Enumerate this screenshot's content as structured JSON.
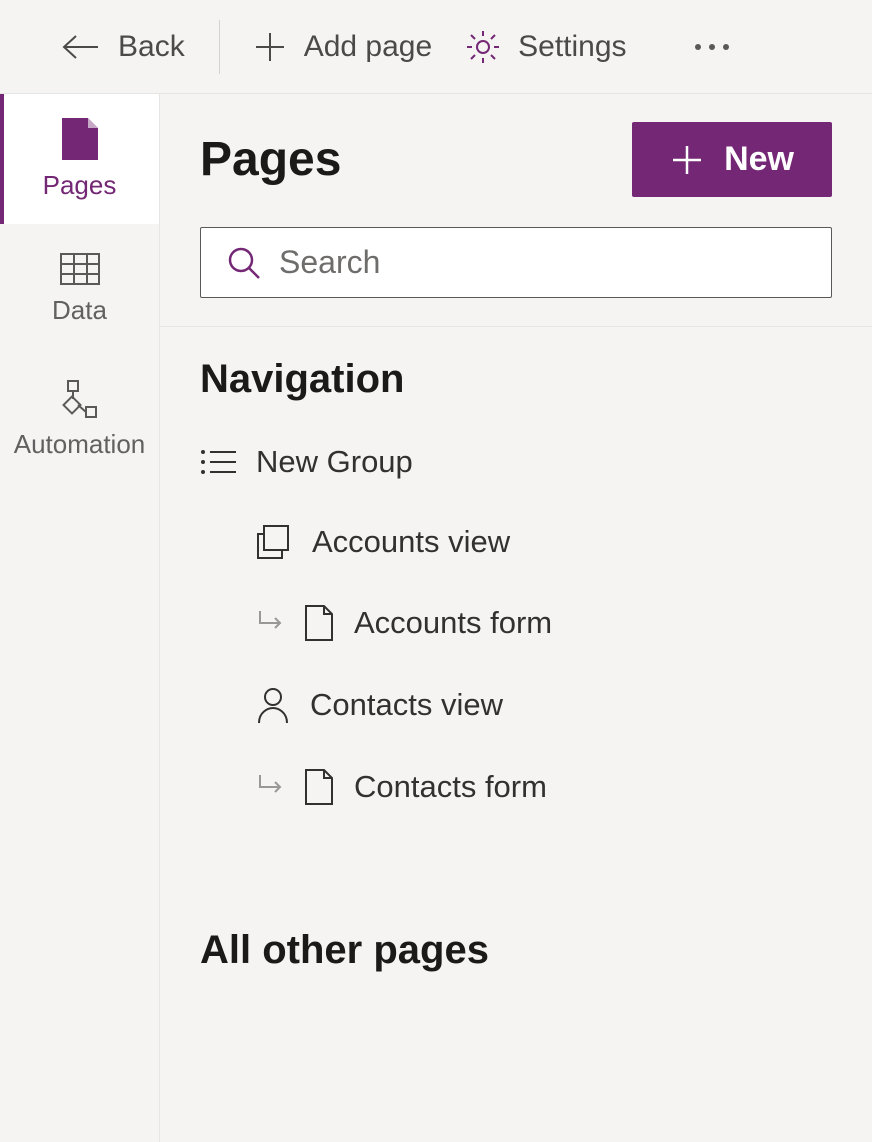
{
  "toolbar": {
    "back": "Back",
    "add_page": "Add page",
    "settings": "Settings"
  },
  "rail": {
    "tabs": [
      {
        "label": "Pages"
      },
      {
        "label": "Data"
      },
      {
        "label": "Automation"
      }
    ]
  },
  "panel": {
    "title": "Pages",
    "new_button": "New",
    "search_placeholder": "Search"
  },
  "navigation": {
    "title": "Navigation",
    "group": "New Group",
    "items": [
      {
        "label": "Accounts view"
      },
      {
        "label": "Accounts form"
      },
      {
        "label": "Contacts view"
      },
      {
        "label": "Contacts form"
      }
    ]
  },
  "other_pages": {
    "title": "All other pages"
  },
  "colors": {
    "accent": "#742774"
  }
}
